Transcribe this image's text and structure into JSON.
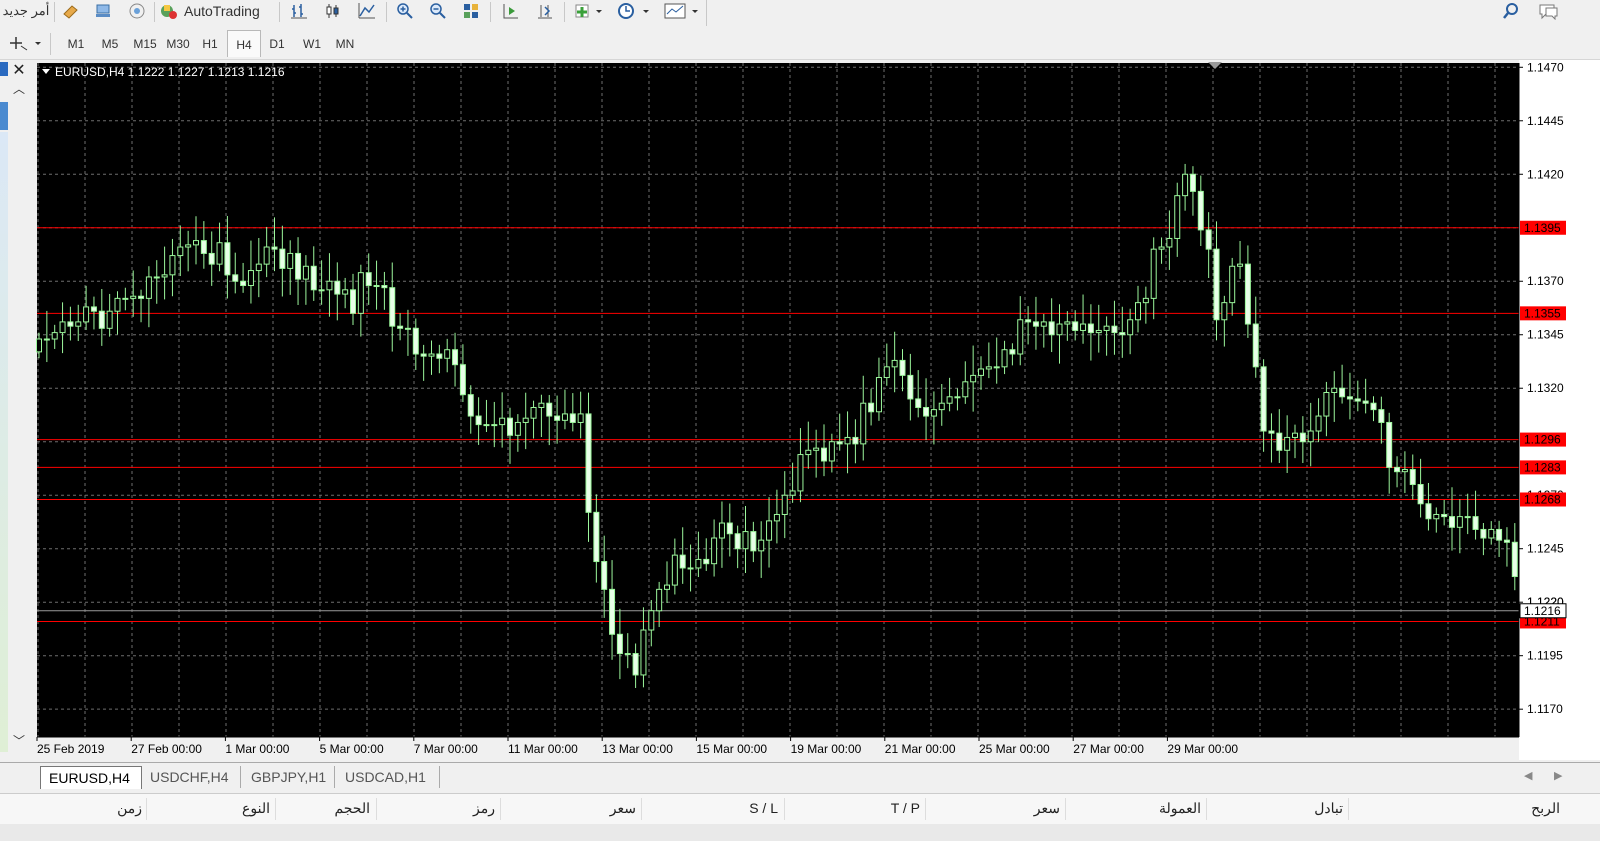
{
  "toolbar": {
    "new_order_label": "أمر جديد",
    "autotrading_label": "AutoTrading",
    "icons": [
      "new-order-icon",
      "meta-editor-icon",
      "market-watch-icon",
      "signals-icon",
      "autotrading-icon",
      "bar-chart-icon",
      "candlestick-icon",
      "line-chart-icon",
      "zoom-in-icon",
      "zoom-out-icon",
      "tile-windows-icon",
      "chart-shift-icon",
      "autoscroll-icon",
      "indicators-icon",
      "periods-icon",
      "templates-icon",
      "search-icon",
      "chat-icon"
    ]
  },
  "timeframes": [
    "M1",
    "M5",
    "M15",
    "M30",
    "H1",
    "H4",
    "D1",
    "W1",
    "MN"
  ],
  "active_timeframe": "H4",
  "chart": {
    "header": "EURUSD,H4  1.1222 1.1227 1.1213 1.1216",
    "background": "#000000",
    "grid_color": "#6e6e6e",
    "bull_color": "#9cf79c",
    "hline_color": "#ff0000"
  },
  "chart_data": {
    "type": "candlestick",
    "symbol": "EURUSD",
    "timeframe": "H4",
    "ohlc_last": {
      "open": 1.1222,
      "high": 1.1227,
      "low": 1.1213,
      "close": 1.1216
    },
    "ylim": [
      1.1157,
      1.1472
    ],
    "y_ticks": [
      1.147,
      1.1445,
      1.142,
      1.137,
      1.1345,
      1.132,
      1.1245,
      1.122,
      1.1195,
      1.117
    ],
    "x_ticks": [
      "25 Feb 2019",
      "27 Feb 00:00",
      "1 Mar 00:00",
      "5 Mar 00:00",
      "7 Mar 00:00",
      "11 Mar 00:00",
      "13 Mar 00:00",
      "15 Mar 00:00",
      "19 Mar 00:00",
      "21 Mar 00:00",
      "25 Mar 00:00",
      "27 Mar 00:00",
      "29 Mar 00:00"
    ],
    "horizontal_lines": [
      1.1395,
      1.1355,
      1.1296,
      1.1283,
      1.1268,
      1.1211
    ],
    "hidden_tick_labels": [
      1.127,
      1.122
    ],
    "current_price": 1.1216,
    "bar_count": 148,
    "bars_per_x_tick": 12,
    "closes": [
      1.1343,
      1.1343,
      1.1346,
      1.1351,
      1.1349,
      1.1351,
      1.1358,
      1.1356,
      1.1348,
      1.1356,
      1.1362,
      1.1362,
      1.1363,
      1.1362,
      1.1372,
      1.1372,
      1.1373,
      1.1382,
      1.1386,
      1.1387,
      1.1389,
      1.1383,
      1.1378,
      1.1388,
      1.1373,
      1.137,
      1.1368,
      1.1375,
      1.1378,
      1.1386,
      1.1385,
      1.1376,
      1.1383,
      1.1371,
      1.1377,
      1.1366,
      1.1366,
      1.137,
      1.1364,
      1.1366,
      1.1355,
      1.1374,
      1.1368,
      1.1368,
      1.1367,
      1.1349,
      1.1348,
      1.1348,
      1.1336,
      1.1335,
      1.1336,
      1.1334,
      1.1338,
      1.1331,
      1.1317,
      1.1307,
      1.1303,
      1.1303,
      1.1303,
      1.1306,
      1.1298,
      1.1304,
      1.1306,
      1.1311,
      1.1313,
      1.1307,
      1.1305,
      1.1308,
      1.1304,
      1.1308,
      1.1262,
      1.1239,
      1.1226,
      1.1205,
      1.1196,
      1.1196,
      1.1186,
      1.1207,
      1.1216,
      1.1226,
      1.1228,
      1.1242,
      1.1236,
      1.1236,
      1.124,
      1.1238,
      1.125,
      1.1257,
      1.1252,
      1.1245,
      1.1253,
      1.1244,
      1.1249,
      1.1258,
      1.1261,
      1.127,
      1.1272,
      1.1289,
      1.1291,
      1.1292,
      1.1286,
      1.1295,
      1.1294,
      1.1297,
      1.1294,
      1.1313,
      1.1309,
      1.1325,
      1.133,
      1.1333,
      1.1326,
      1.1315,
      1.1311,
      1.1307,
      1.131,
      1.1313,
      1.1316,
      1.1316,
      1.1323,
      1.1326,
      1.1329,
      1.133,
      1.133,
      1.1338,
      1.1336,
      1.1352,
      1.1351,
      1.1349,
      1.1351,
      1.1345,
      1.135,
      1.1351,
      1.1347,
      1.135,
      1.1346,
      1.1347,
      1.1349,
      1.1346,
      1.1345,
      1.1352,
      1.136,
      1.1362,
      1.1385,
      1.1386,
      1.139,
      1.141,
      1.142,
      1.1412,
      1.1394,
      1.1385,
      1.1352,
      1.136,
      1.1377,
      1.1378,
      1.135,
      1.133,
      1.13,
      1.1299,
      1.1291,
      1.1297,
      1.1299,
      1.1295,
      1.13,
      1.1307,
      1.1318,
      1.132,
      1.1316,
      1.1315,
      1.1314,
      1.1313,
      1.131,
      1.1304,
      1.1283,
      1.1281,
      1.1282,
      1.1275,
      1.1266,
      1.1259,
      1.1261,
      1.126,
      1.1255,
      1.126,
      1.126,
      1.1254,
      1.125,
      1.1254,
      1.1249,
      1.1248,
      1.1232,
      1.1225,
      1.1224,
      1.1233,
      1.123,
      1.1221,
      1.1222,
      1.1236,
      1.1226,
      1.1216,
      1.1212,
      1.1216
    ]
  },
  "symbol_tabs": [
    "EURUSD,H4",
    "USDCHF,H4",
    "GBPJPY,H1",
    "USDCAD,H1"
  ],
  "active_tab": "EURUSD,H4",
  "terminal_columns": [
    "زمن",
    "النوع",
    "الحجم",
    "رمز",
    "سعر",
    "S / L",
    "T / P",
    "سعر",
    "العمولة",
    "تبادل",
    "الربح"
  ]
}
